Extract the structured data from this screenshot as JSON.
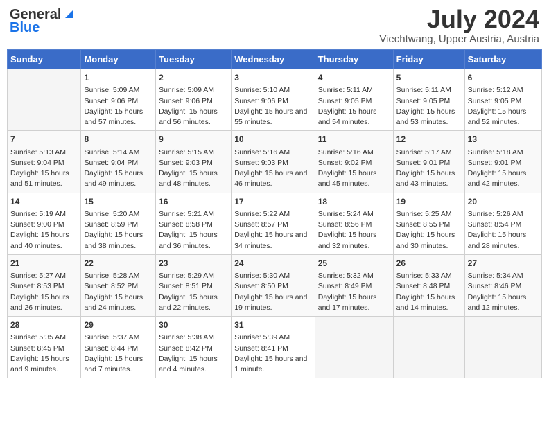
{
  "header": {
    "logo_line1": "General",
    "logo_line2": "Blue",
    "title": "July 2024",
    "subtitle": "Viechtwang, Upper Austria, Austria"
  },
  "calendar": {
    "days_of_week": [
      "Sunday",
      "Monday",
      "Tuesday",
      "Wednesday",
      "Thursday",
      "Friday",
      "Saturday"
    ],
    "weeks": [
      [
        {
          "day": "",
          "empty": true
        },
        {
          "day": "1",
          "sunrise": "Sunrise: 5:09 AM",
          "sunset": "Sunset: 9:06 PM",
          "daylight": "Daylight: 15 hours and 57 minutes."
        },
        {
          "day": "2",
          "sunrise": "Sunrise: 5:09 AM",
          "sunset": "Sunset: 9:06 PM",
          "daylight": "Daylight: 15 hours and 56 minutes."
        },
        {
          "day": "3",
          "sunrise": "Sunrise: 5:10 AM",
          "sunset": "Sunset: 9:06 PM",
          "daylight": "Daylight: 15 hours and 55 minutes."
        },
        {
          "day": "4",
          "sunrise": "Sunrise: 5:11 AM",
          "sunset": "Sunset: 9:05 PM",
          "daylight": "Daylight: 15 hours and 54 minutes."
        },
        {
          "day": "5",
          "sunrise": "Sunrise: 5:11 AM",
          "sunset": "Sunset: 9:05 PM",
          "daylight": "Daylight: 15 hours and 53 minutes."
        },
        {
          "day": "6",
          "sunrise": "Sunrise: 5:12 AM",
          "sunset": "Sunset: 9:05 PM",
          "daylight": "Daylight: 15 hours and 52 minutes."
        }
      ],
      [
        {
          "day": "7",
          "sunrise": "Sunrise: 5:13 AM",
          "sunset": "Sunset: 9:04 PM",
          "daylight": "Daylight: 15 hours and 51 minutes."
        },
        {
          "day": "8",
          "sunrise": "Sunrise: 5:14 AM",
          "sunset": "Sunset: 9:04 PM",
          "daylight": "Daylight: 15 hours and 49 minutes."
        },
        {
          "day": "9",
          "sunrise": "Sunrise: 5:15 AM",
          "sunset": "Sunset: 9:03 PM",
          "daylight": "Daylight: 15 hours and 48 minutes."
        },
        {
          "day": "10",
          "sunrise": "Sunrise: 5:16 AM",
          "sunset": "Sunset: 9:03 PM",
          "daylight": "Daylight: 15 hours and 46 minutes."
        },
        {
          "day": "11",
          "sunrise": "Sunrise: 5:16 AM",
          "sunset": "Sunset: 9:02 PM",
          "daylight": "Daylight: 15 hours and 45 minutes."
        },
        {
          "day": "12",
          "sunrise": "Sunrise: 5:17 AM",
          "sunset": "Sunset: 9:01 PM",
          "daylight": "Daylight: 15 hours and 43 minutes."
        },
        {
          "day": "13",
          "sunrise": "Sunrise: 5:18 AM",
          "sunset": "Sunset: 9:01 PM",
          "daylight": "Daylight: 15 hours and 42 minutes."
        }
      ],
      [
        {
          "day": "14",
          "sunrise": "Sunrise: 5:19 AM",
          "sunset": "Sunset: 9:00 PM",
          "daylight": "Daylight: 15 hours and 40 minutes."
        },
        {
          "day": "15",
          "sunrise": "Sunrise: 5:20 AM",
          "sunset": "Sunset: 8:59 PM",
          "daylight": "Daylight: 15 hours and 38 minutes."
        },
        {
          "day": "16",
          "sunrise": "Sunrise: 5:21 AM",
          "sunset": "Sunset: 8:58 PM",
          "daylight": "Daylight: 15 hours and 36 minutes."
        },
        {
          "day": "17",
          "sunrise": "Sunrise: 5:22 AM",
          "sunset": "Sunset: 8:57 PM",
          "daylight": "Daylight: 15 hours and 34 minutes."
        },
        {
          "day": "18",
          "sunrise": "Sunrise: 5:24 AM",
          "sunset": "Sunset: 8:56 PM",
          "daylight": "Daylight: 15 hours and 32 minutes."
        },
        {
          "day": "19",
          "sunrise": "Sunrise: 5:25 AM",
          "sunset": "Sunset: 8:55 PM",
          "daylight": "Daylight: 15 hours and 30 minutes."
        },
        {
          "day": "20",
          "sunrise": "Sunrise: 5:26 AM",
          "sunset": "Sunset: 8:54 PM",
          "daylight": "Daylight: 15 hours and 28 minutes."
        }
      ],
      [
        {
          "day": "21",
          "sunrise": "Sunrise: 5:27 AM",
          "sunset": "Sunset: 8:53 PM",
          "daylight": "Daylight: 15 hours and 26 minutes."
        },
        {
          "day": "22",
          "sunrise": "Sunrise: 5:28 AM",
          "sunset": "Sunset: 8:52 PM",
          "daylight": "Daylight: 15 hours and 24 minutes."
        },
        {
          "day": "23",
          "sunrise": "Sunrise: 5:29 AM",
          "sunset": "Sunset: 8:51 PM",
          "daylight": "Daylight: 15 hours and 22 minutes."
        },
        {
          "day": "24",
          "sunrise": "Sunrise: 5:30 AM",
          "sunset": "Sunset: 8:50 PM",
          "daylight": "Daylight: 15 hours and 19 minutes."
        },
        {
          "day": "25",
          "sunrise": "Sunrise: 5:32 AM",
          "sunset": "Sunset: 8:49 PM",
          "daylight": "Daylight: 15 hours and 17 minutes."
        },
        {
          "day": "26",
          "sunrise": "Sunrise: 5:33 AM",
          "sunset": "Sunset: 8:48 PM",
          "daylight": "Daylight: 15 hours and 14 minutes."
        },
        {
          "day": "27",
          "sunrise": "Sunrise: 5:34 AM",
          "sunset": "Sunset: 8:46 PM",
          "daylight": "Daylight: 15 hours and 12 minutes."
        }
      ],
      [
        {
          "day": "28",
          "sunrise": "Sunrise: 5:35 AM",
          "sunset": "Sunset: 8:45 PM",
          "daylight": "Daylight: 15 hours and 9 minutes."
        },
        {
          "day": "29",
          "sunrise": "Sunrise: 5:37 AM",
          "sunset": "Sunset: 8:44 PM",
          "daylight": "Daylight: 15 hours and 7 minutes."
        },
        {
          "day": "30",
          "sunrise": "Sunrise: 5:38 AM",
          "sunset": "Sunset: 8:42 PM",
          "daylight": "Daylight: 15 hours and 4 minutes."
        },
        {
          "day": "31",
          "sunrise": "Sunrise: 5:39 AM",
          "sunset": "Sunset: 8:41 PM",
          "daylight": "Daylight: 15 hours and 1 minute."
        },
        {
          "day": "",
          "empty": true
        },
        {
          "day": "",
          "empty": true
        },
        {
          "day": "",
          "empty": true
        }
      ]
    ]
  }
}
